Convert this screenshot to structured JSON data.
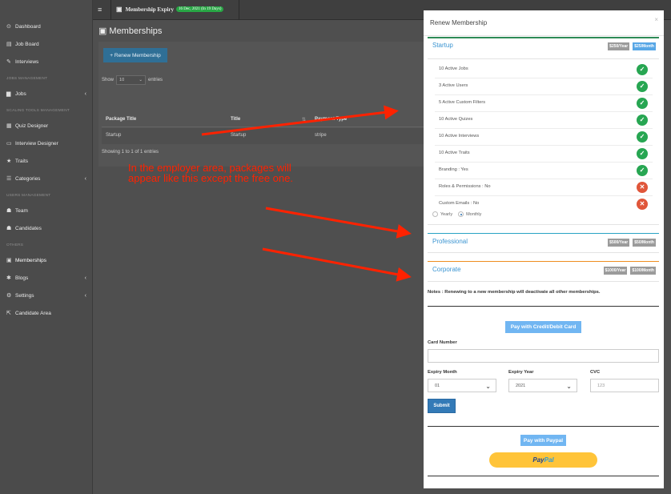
{
  "sidebar": {
    "items": [
      {
        "label": "Dashboard",
        "icon": "dashboard-icon",
        "glyph": "⊙"
      },
      {
        "label": "Job Board",
        "icon": "board-icon",
        "glyph": "▤"
      },
      {
        "label": "Interviews",
        "icon": "interview-icon",
        "glyph": "✎"
      },
      {
        "label": "Jobs",
        "icon": "briefcase-icon",
        "glyph": "▆"
      },
      {
        "label": "Quiz Designer",
        "icon": "quiz-icon",
        "glyph": "▦"
      },
      {
        "label": "Interview Designer",
        "icon": "designer-icon",
        "glyph": "▭"
      },
      {
        "label": "Traits",
        "icon": "star-icon",
        "glyph": "★"
      },
      {
        "label": "Categories",
        "icon": "list-icon",
        "glyph": "☰"
      },
      {
        "label": "Team",
        "icon": "team-icon",
        "glyph": "☗"
      },
      {
        "label": "Candidates",
        "icon": "candidates-icon",
        "glyph": "☗"
      },
      {
        "label": "Memberships",
        "icon": "id-badge-icon",
        "glyph": "▣"
      },
      {
        "label": "Blogs",
        "icon": "blog-icon",
        "glyph": "✱"
      },
      {
        "label": "Settings",
        "icon": "settings-icon",
        "glyph": "⚙"
      },
      {
        "label": "Candidate Area",
        "icon": "external-link-icon",
        "glyph": "⇱"
      }
    ],
    "headings": [
      "JOBS MANAGEMENT",
      "SCALING TOOLS MANAGEMENT",
      "USERS MANAGEMENT",
      "OTHERS"
    ]
  },
  "topbar": {
    "expiry_label": "Membership Expiry",
    "expiry_badge": "16 Dec, 2021 (In 19 Days)"
  },
  "page": {
    "title": "Memberships",
    "renew_button": "+ Renew Membership",
    "show_label": "Show",
    "entries_value": "10",
    "entries_label": "entries",
    "columns": [
      "Package Title",
      "Title",
      "Payment Type"
    ],
    "row": [
      "Startup",
      "Startup",
      "stripe"
    ],
    "showing": "Showing 1 to 1 of 1 entries"
  },
  "annotation": {
    "text": "In the employer area, packages will appear like this except the free one."
  },
  "modal": {
    "title": "Renew Membership",
    "close": "×",
    "packages": [
      {
        "name": "Startup",
        "year": "$250/Year",
        "month": "$25/Month",
        "color": "#2e8b57"
      },
      {
        "name": "Professional",
        "year": "$500/Year",
        "month": "$50/Month",
        "color": "#29a3c4"
      },
      {
        "name": "Corporate",
        "year": "$1000/Year",
        "month": "$100/Month",
        "color": "#ee8d1f"
      }
    ],
    "features": [
      {
        "label": "10 Active Jobs",
        "ok": true
      },
      {
        "label": "3 Active Users",
        "ok": true
      },
      {
        "label": "5 Active Custom Filters",
        "ok": true
      },
      {
        "label": "10 Active Quizes",
        "ok": true
      },
      {
        "label": "10 Active Interviews",
        "ok": true
      },
      {
        "label": "10 Active Traits",
        "ok": true
      },
      {
        "label": "Branding : Yes",
        "ok": true
      },
      {
        "label": "Roles & Permissions : No",
        "ok": false
      },
      {
        "label": "Custom Emails : No",
        "ok": false
      }
    ],
    "billing": {
      "yearly": "Yearly",
      "monthly": "Monthly",
      "selected": "Monthly"
    },
    "notes": "Notes : Renewing to a new membership will deactivate all other memberships.",
    "pay_card_button": "Pay with Credit/Debit Card",
    "card_number_label": "Card Number",
    "card_number_value": "",
    "expiry_month_label": "Expiry Month",
    "expiry_month_value": "01",
    "expiry_year_label": "Expiry Year",
    "expiry_year_value": "2021",
    "cvc_label": "CVC",
    "cvc_placeholder": "123",
    "submit_button": "Submit",
    "pay_paypal_button": "Pay with Paypal",
    "paypal_part1": "Pay",
    "paypal_part2": "Pal"
  },
  "colors": {
    "accent": "#3a94d1",
    "check": "#27a652",
    "cross": "#e0563a",
    "annotation": "#ff2200"
  }
}
